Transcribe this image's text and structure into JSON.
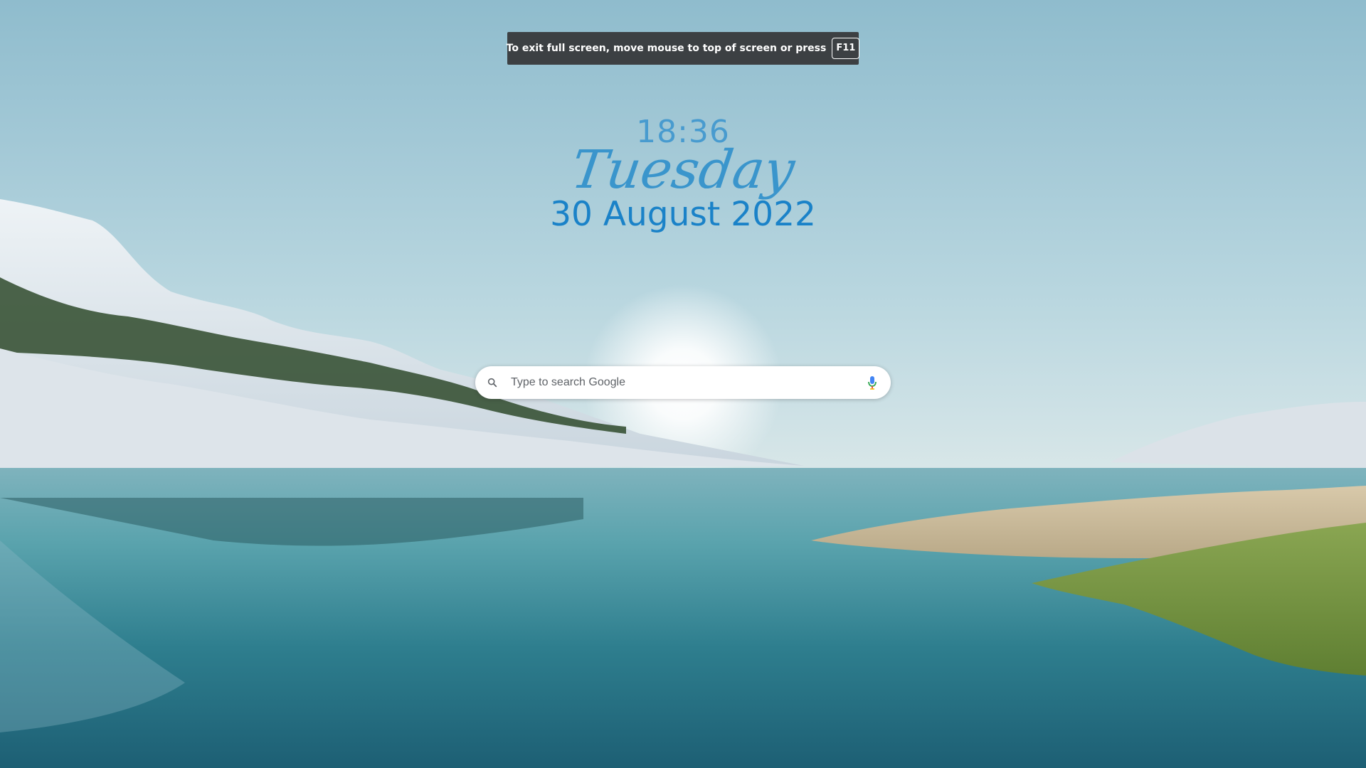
{
  "fullscreen_notice": {
    "message": "To exit full screen, move mouse to top of screen or press",
    "key": "F11"
  },
  "clock": {
    "time": "18:36",
    "weekday": "Tuesday",
    "date": "30 August 2022"
  },
  "search": {
    "placeholder": "Type to search Google",
    "value": ""
  },
  "icons": {
    "search": "search-icon",
    "microphone": "microphone-icon"
  },
  "colors": {
    "clock_text": "#3f97cf",
    "date_text": "#1a82c8",
    "banner_bg": "#3c4043"
  }
}
